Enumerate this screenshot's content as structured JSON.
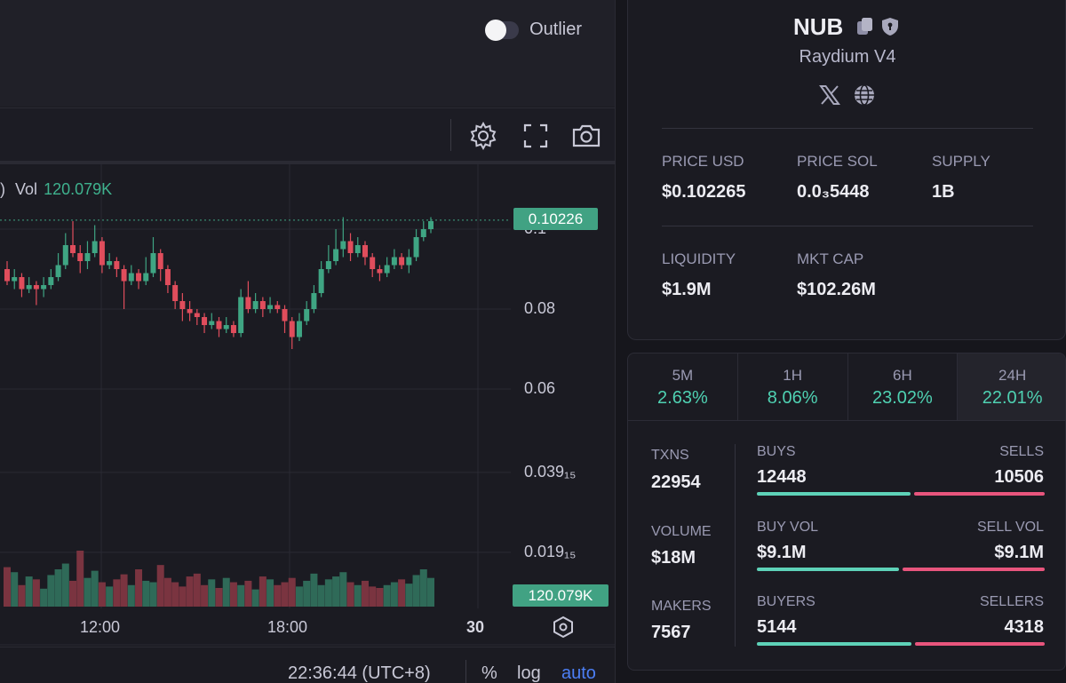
{
  "toolbar": {
    "outlier_label": "Outlier",
    "icons": [
      "gear-icon",
      "fullscreen-icon",
      "camera-icon"
    ]
  },
  "chart_data": {
    "type": "candlestick",
    "legend": {
      "prefix": ")",
      "vol_label": "Vol",
      "vol_value": "120.079K"
    },
    "current_price_label": "0.10226",
    "current_volume_label": "120.079K",
    "y_ticks": [
      {
        "value": 0.1,
        "label": "0.1"
      },
      {
        "value": 0.08,
        "label": "0.08"
      },
      {
        "value": 0.06,
        "label": "0.06"
      },
      {
        "value": 0.03915,
        "label": "0.039₁₅"
      },
      {
        "value": 0.01915,
        "label": "0.019₁₅"
      }
    ],
    "x_ticks": [
      "12:00",
      "18:00",
      "30"
    ],
    "ylim": [
      0.005,
      0.115
    ],
    "candles": [
      [
        0.09,
        0.087,
        0.092,
        0.086
      ],
      [
        0.087,
        0.088,
        0.09,
        0.085
      ],
      [
        0.088,
        0.085,
        0.089,
        0.083
      ],
      [
        0.085,
        0.086,
        0.088,
        0.084
      ],
      [
        0.086,
        0.085,
        0.087,
        0.081
      ],
      [
        0.085,
        0.086,
        0.088,
        0.083
      ],
      [
        0.086,
        0.088,
        0.09,
        0.085
      ],
      [
        0.088,
        0.091,
        0.094,
        0.087
      ],
      [
        0.091,
        0.096,
        0.099,
        0.09
      ],
      [
        0.096,
        0.094,
        0.102,
        0.093
      ],
      [
        0.094,
        0.092,
        0.096,
        0.089
      ],
      [
        0.092,
        0.094,
        0.097,
        0.09
      ],
      [
        0.094,
        0.097,
        0.101,
        0.093
      ],
      [
        0.097,
        0.091,
        0.098,
        0.089
      ],
      [
        0.091,
        0.092,
        0.094,
        0.09
      ],
      [
        0.092,
        0.09,
        0.093,
        0.088
      ],
      [
        0.09,
        0.087,
        0.091,
        0.08
      ],
      [
        0.087,
        0.089,
        0.091,
        0.086
      ],
      [
        0.089,
        0.087,
        0.09,
        0.085
      ],
      [
        0.087,
        0.089,
        0.093,
        0.086
      ],
      [
        0.089,
        0.094,
        0.098,
        0.088
      ],
      [
        0.094,
        0.09,
        0.095,
        0.087
      ],
      [
        0.09,
        0.086,
        0.091,
        0.084
      ],
      [
        0.086,
        0.082,
        0.087,
        0.08
      ],
      [
        0.082,
        0.08,
        0.084,
        0.077
      ],
      [
        0.08,
        0.079,
        0.082,
        0.077
      ],
      [
        0.079,
        0.078,
        0.08,
        0.076
      ],
      [
        0.078,
        0.076,
        0.079,
        0.074
      ],
      [
        0.076,
        0.077,
        0.079,
        0.075
      ],
      [
        0.077,
        0.075,
        0.078,
        0.073
      ],
      [
        0.075,
        0.076,
        0.078,
        0.074
      ],
      [
        0.076,
        0.074,
        0.077,
        0.073
      ],
      [
        0.074,
        0.083,
        0.085,
        0.073
      ],
      [
        0.083,
        0.08,
        0.087,
        0.079
      ],
      [
        0.08,
        0.082,
        0.084,
        0.079
      ],
      [
        0.082,
        0.08,
        0.083,
        0.078
      ],
      [
        0.08,
        0.081,
        0.083,
        0.079
      ],
      [
        0.081,
        0.08,
        0.082,
        0.079
      ],
      [
        0.08,
        0.077,
        0.081,
        0.074
      ],
      [
        0.077,
        0.073,
        0.078,
        0.07
      ],
      [
        0.073,
        0.077,
        0.079,
        0.072
      ],
      [
        0.077,
        0.08,
        0.082,
        0.076
      ],
      [
        0.08,
        0.084,
        0.086,
        0.079
      ],
      [
        0.084,
        0.09,
        0.092,
        0.083
      ],
      [
        0.09,
        0.092,
        0.096,
        0.089
      ],
      [
        0.092,
        0.095,
        0.1,
        0.091
      ],
      [
        0.095,
        0.097,
        0.103,
        0.093
      ],
      [
        0.097,
        0.094,
        0.099,
        0.092
      ],
      [
        0.094,
        0.096,
        0.098,
        0.093
      ],
      [
        0.096,
        0.093,
        0.097,
        0.091
      ],
      [
        0.093,
        0.09,
        0.094,
        0.088
      ],
      [
        0.09,
        0.089,
        0.091,
        0.087
      ],
      [
        0.089,
        0.091,
        0.093,
        0.088
      ],
      [
        0.091,
        0.093,
        0.095,
        0.09
      ],
      [
        0.093,
        0.091,
        0.094,
        0.09
      ],
      [
        0.091,
        0.093,
        0.095,
        0.089
      ],
      [
        0.093,
        0.098,
        0.1,
        0.092
      ],
      [
        0.098,
        0.1,
        0.102,
        0.097
      ],
      [
        0.1,
        0.102,
        0.103,
        0.099
      ]
    ],
    "volumes": [
      55,
      48,
      30,
      42,
      38,
      25,
      44,
      52,
      60,
      36,
      78,
      40,
      50,
      34,
      28,
      38,
      45,
      30,
      52,
      36,
      34,
      58,
      40,
      34,
      28,
      42,
      46,
      30,
      38,
      26,
      40,
      34,
      30,
      36,
      24,
      42,
      38,
      30,
      34,
      40,
      28,
      36,
      46,
      30,
      38,
      42,
      48,
      34,
      30,
      36,
      28,
      26,
      30,
      34,
      38,
      32,
      44,
      52,
      40
    ]
  },
  "token": {
    "name": "NUB",
    "dex": "Raydium V4",
    "icons": [
      "copy-icon",
      "shield-icon",
      "x-twitter-icon",
      "globe-icon"
    ],
    "stats_row1": [
      {
        "label": "PRICE USD",
        "value": "$0.102265"
      },
      {
        "label": "PRICE SOL",
        "value": "0.0₃5448"
      },
      {
        "label": "SUPPLY",
        "value": "1B"
      }
    ],
    "stats_row2": [
      {
        "label": "LIQUIDITY",
        "value": "$1.9M"
      },
      {
        "label": "MKT CAP",
        "value": "$102.26M"
      }
    ]
  },
  "changes": {
    "tabs": [
      {
        "label": "5M",
        "value": "2.63%"
      },
      {
        "label": "1H",
        "value": "8.06%"
      },
      {
        "label": "6H",
        "value": "23.02%"
      },
      {
        "label": "24H",
        "value": "22.01%"
      }
    ],
    "colors": {
      "positive": "#4fd1b2",
      "buy_bar": "#5ed2b8",
      "sell_bar": "#e8557d"
    }
  },
  "trades": {
    "txns": {
      "label": "TXNS",
      "value": "22954"
    },
    "volume": {
      "label": "VOLUME",
      "value": "$18M"
    },
    "makers": {
      "label": "MAKERS",
      "value": "7567"
    },
    "buys": {
      "label": "BUYS",
      "value": "12448",
      "sell_label": "SELLS",
      "sell_value": "10506",
      "buy_fraction": 0.542
    },
    "buy_vol": {
      "label": "BUY VOL",
      "value": "$9.1M",
      "sell_label": "SELL VOL",
      "sell_value": "$9.1M",
      "buy_fraction": 0.5
    },
    "buyers": {
      "label": "BUYERS",
      "value": "5144",
      "sell_label": "SELLERS",
      "sell_value": "4318",
      "buy_fraction": 0.544
    }
  },
  "footer": {
    "clock": "22:36:44 (UTC+8)",
    "percent_label": "%",
    "log_label": "log",
    "auto_label": "auto"
  }
}
